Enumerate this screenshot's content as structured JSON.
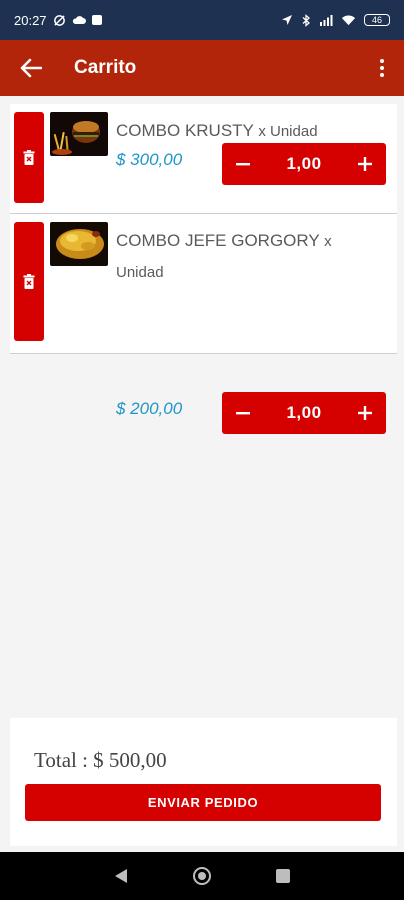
{
  "status_bar": {
    "time": "20:27",
    "battery": "46"
  },
  "app_bar": {
    "title": "Carrito"
  },
  "cart": {
    "items": [
      {
        "name": "COMBO KRUSTY",
        "unit": "x Unidad",
        "price": "$ 300,00",
        "quantity": "1,00"
      },
      {
        "name": "COMBO JEFE GORGORY",
        "unit": "x Unidad",
        "price": "$ 200,00",
        "quantity": "1,00"
      }
    ]
  },
  "footer": {
    "total_label": "Total : $ 500,00",
    "send_label": "ENVIAR PEDIDO"
  },
  "colors": {
    "status_bar": "#1f3150",
    "app_bar": "#b3250a",
    "accent_red": "#d50000",
    "price_blue": "#2196c8"
  }
}
